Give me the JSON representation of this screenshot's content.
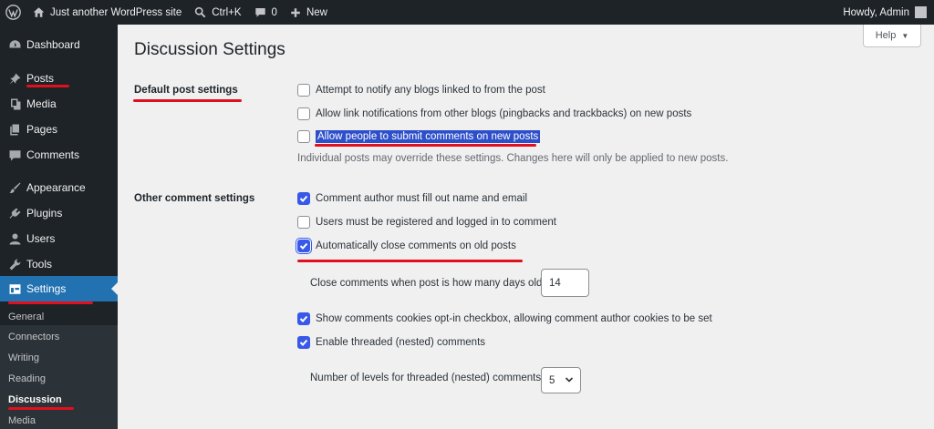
{
  "adminbar": {
    "site_name": "Just another WordPress site",
    "search_shortcut": "Ctrl+K",
    "comments_count": "0",
    "new_label": "New",
    "greeting": "Howdy, Admin"
  },
  "sidebar": {
    "items": [
      {
        "label": "Dashboard",
        "icon": "dashboard-icon"
      },
      {
        "label": "Posts",
        "icon": "pin-icon"
      },
      {
        "label": "Media",
        "icon": "media-icon"
      },
      {
        "label": "Pages",
        "icon": "pages-icon"
      },
      {
        "label": "Comments",
        "icon": "comment-icon"
      },
      {
        "label": "Appearance",
        "icon": "brush-icon"
      },
      {
        "label": "Plugins",
        "icon": "plugin-icon"
      },
      {
        "label": "Users",
        "icon": "user-icon"
      },
      {
        "label": "Tools",
        "icon": "wrench-icon"
      },
      {
        "label": "Settings",
        "icon": "settings-icon"
      }
    ],
    "submenu": [
      "General",
      "Connectors",
      "Writing",
      "Reading",
      "Discussion",
      "Media"
    ]
  },
  "main": {
    "title": "Discussion Settings",
    "help_label": "Help",
    "default_section": {
      "label": "Default post settings",
      "options": [
        {
          "label": "Attempt to notify any blogs linked to from the post",
          "checked": false
        },
        {
          "label": "Allow link notifications from other blogs (pingbacks and trackbacks) on new posts",
          "checked": false
        },
        {
          "label": "Allow people to submit comments on new posts",
          "checked": false
        }
      ],
      "description": "Individual posts may override these settings. Changes here will only be applied to new posts."
    },
    "other_section": {
      "label": "Other comment settings",
      "options": [
        {
          "label": "Comment author must fill out name and email",
          "checked": true
        },
        {
          "label": "Users must be registered and logged in to comment",
          "checked": false
        },
        {
          "label": "Automatically close comments on old posts",
          "checked": true
        },
        {
          "label": "Show comments cookies opt-in checkbox, allowing comment author cookies to be set",
          "checked": true
        },
        {
          "label": "Enable threaded (nested) comments",
          "checked": true
        }
      ],
      "close_days_label": "Close comments when post is how many days old",
      "close_days_value": "14",
      "thread_levels_label": "Number of levels for threaded (nested) comments",
      "thread_levels_value": "5"
    }
  },
  "colors": {
    "sidebar_bg": "#1d2327",
    "accent": "#2271b1",
    "checkbox_checked": "#3858e9",
    "annotation_red": "#e0101e"
  }
}
